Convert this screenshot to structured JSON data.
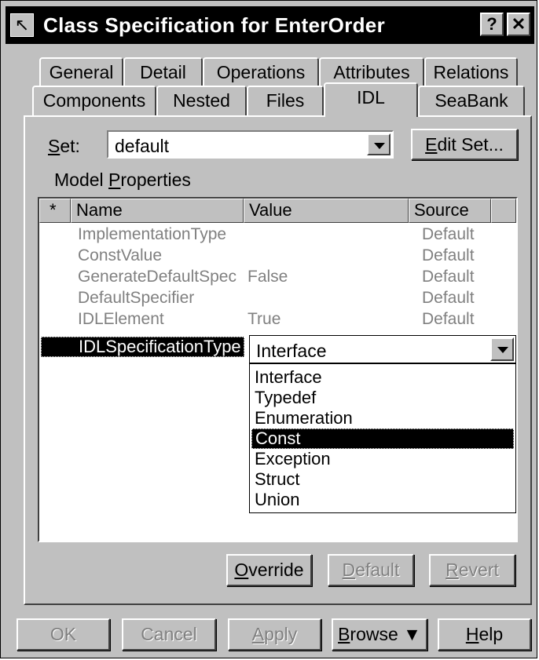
{
  "window": {
    "title": "Class Specification for EnterOrder",
    "help_button": "?",
    "close_button": "✕"
  },
  "tabs": {
    "row1": [
      "General",
      "Detail",
      "Operations",
      "Attributes",
      "Relations"
    ],
    "row2": [
      "Components",
      "Nested",
      "Files",
      "IDL",
      "SeaBank"
    ],
    "active": "IDL"
  },
  "set": {
    "label": "Set:",
    "value": "default",
    "edit_button": "Edit Set..."
  },
  "model_properties": {
    "label": "Model Properties",
    "columns": [
      "*",
      "Name",
      "Value",
      "Source"
    ],
    "rows": [
      {
        "name": "ImplementationType",
        "value": "",
        "source": "Default"
      },
      {
        "name": "ConstValue",
        "value": "",
        "source": "Default"
      },
      {
        "name": "GenerateDefaultSpec",
        "value": "False",
        "source": "Default"
      },
      {
        "name": "DefaultSpecifier",
        "value": "",
        "source": "Default"
      },
      {
        "name": "IDLElement",
        "value": "True",
        "source": "Default"
      }
    ],
    "selected_row": {
      "name": "IDLSpecificationType",
      "value": "Interface"
    },
    "dropdown_options": [
      "Interface",
      "Typedef",
      "Enumeration",
      "Const",
      "Exception",
      "Struct",
      "Union"
    ],
    "highlighted_option": "Const"
  },
  "property_buttons": {
    "override": "Override",
    "default": "Default",
    "revert": "Revert"
  },
  "dialog_buttons": {
    "ok": "OK",
    "cancel": "Cancel",
    "apply": "Apply",
    "browse": "Browse ▼",
    "help": "Help"
  }
}
